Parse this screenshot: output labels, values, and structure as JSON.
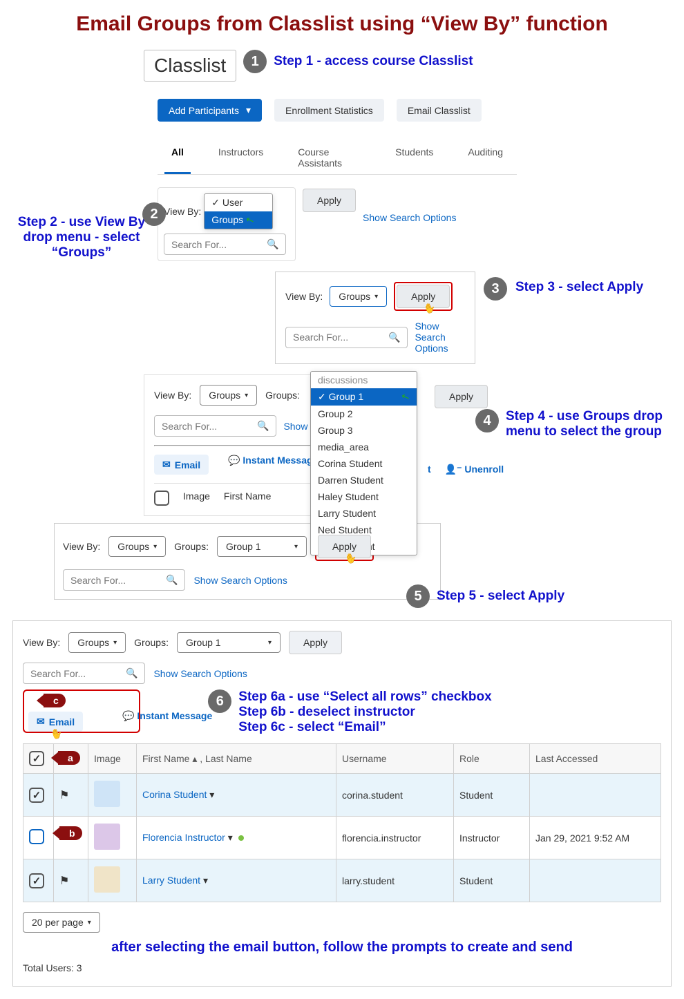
{
  "title": "Email Groups from Classlist using “View By” function",
  "classlist_heading": "Classlist",
  "step1": "Step 1 - access course Classlist",
  "step2": "Step 2 - use View By drop menu - select “Groups”",
  "step3": "Step 3 - select Apply",
  "step4": "Step 4 - use Groups drop menu to select the group",
  "step5": "Step 5 - select Apply",
  "step6a": "Step 6a - use “Select all rows” checkbox",
  "step6b": "Step 6b - deselect instructor",
  "step6c": "Step 6c - select “Email”",
  "buttons": {
    "add_participants": "Add Participants",
    "enrollment_stats": "Enrollment Statistics",
    "email_classlist": "Email Classlist"
  },
  "tabs": {
    "all": "All",
    "instructors": "Instructors",
    "course_assistants": "Course Assistants",
    "students": "Students",
    "auditing": "Auditing"
  },
  "labels": {
    "view_by": "View By:",
    "groups_label": "Groups:",
    "apply": "Apply",
    "search_placeholder": "Search For...",
    "show_search_options": "Show Search Options",
    "email": "Email",
    "instant_message": "Instant Message",
    "print": "Print",
    "unenroll": "Unenroll",
    "per_page": "20 per page"
  },
  "viewby_dropdown": {
    "user": "User",
    "groups": "Groups"
  },
  "viewby_selected": "Groups",
  "groups_selected": "Group 1",
  "groups_dropdown": [
    "discussions",
    "Group 1",
    "Group 2",
    "Group 3",
    "media_area",
    "Corina Student",
    "Darren Student",
    "Haley Student",
    "Larry Student",
    "Ned Student",
    "Sally Student"
  ],
  "table": {
    "headers": {
      "image": "Image",
      "name": "First Name ▴ , Last Name",
      "username": "Username",
      "role": "Role",
      "last_accessed": "Last Accessed"
    },
    "rows": [
      {
        "checked": true,
        "flag": true,
        "name": "Corina Student",
        "username": "corina.student",
        "role": "Student",
        "last": "",
        "online": false
      },
      {
        "checked": false,
        "flag": true,
        "name": "Florencia Instructor",
        "username": "florencia.instructor",
        "role": "Instructor",
        "last": "Jan 29, 2021 9:52 AM",
        "online": true
      },
      {
        "checked": true,
        "flag": true,
        "name": "Larry Student",
        "username": "larry.student",
        "role": "Student",
        "last": "",
        "online": false
      }
    ]
  },
  "footer_caption": "after selecting the email button, follow the prompts to create and send",
  "total_users": "Total Users: 3",
  "markers": {
    "a": "a",
    "b": "b",
    "c": "c",
    "n1": "1",
    "n2": "2",
    "n3": "3",
    "n4": "4",
    "n5": "5",
    "n6": "6"
  }
}
